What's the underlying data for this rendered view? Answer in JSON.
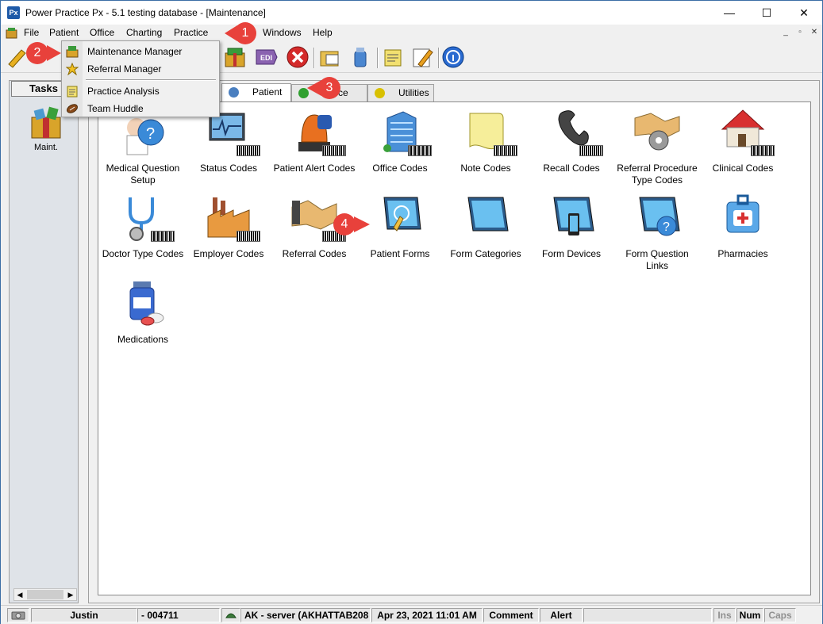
{
  "window": {
    "icon_text": "Px",
    "title": "Power Practice Px - 5.1 testing database - [Maintenance]",
    "minimize_glyph": "—",
    "maximize_glyph": "☐",
    "close_glyph": "✕"
  },
  "menubar": {
    "items": [
      "File",
      "Patient",
      "Office",
      "Charting",
      "Practice",
      "Windows",
      "Help"
    ],
    "mdi_controls": [
      "_",
      "▫",
      "✕"
    ]
  },
  "dropdown": {
    "items": [
      {
        "label": "Maintenance Manager",
        "icon": "maintenance-box-icon"
      },
      {
        "label": "Referral Manager",
        "icon": "star-icon"
      },
      {
        "label": "Practice Analysis",
        "icon": "notepad-icon"
      },
      {
        "label": "Team Huddle",
        "icon": "football-icon"
      }
    ]
  },
  "tasks": {
    "header": "Tasks",
    "items": [
      {
        "label": "Maint.",
        "icon": "maintenance-box-icon"
      }
    ]
  },
  "tabs": [
    {
      "label": "Patient",
      "color": "#4a7fc0"
    },
    {
      "label": "ce",
      "color": "#2fa02f"
    },
    {
      "label": "Utilities",
      "color": "#d8c000"
    }
  ],
  "icons": [
    {
      "label": "Medical Question Setup",
      "icon": "nurse-question-icon"
    },
    {
      "label": "Status Codes",
      "icon": "monitor-barcode-icon"
    },
    {
      "label": "Patient Alert Codes",
      "icon": "siren-icon"
    },
    {
      "label": "Office Codes",
      "icon": "building-icon"
    },
    {
      "label": "Note Codes",
      "icon": "scroll-icon"
    },
    {
      "label": "Recall Codes",
      "icon": "phone-icon"
    },
    {
      "label": "Referral Procedure Type Codes",
      "icon": "handshake-gear-icon"
    },
    {
      "label": "Clinical Codes",
      "icon": "house-icon"
    },
    {
      "label": "Doctor Type Codes",
      "icon": "stethoscope-icon"
    },
    {
      "label": "Employer Codes",
      "icon": "factory-icon"
    },
    {
      "label": "Referral Codes",
      "icon": "handshake-icon"
    },
    {
      "label": "Patient Forms",
      "icon": "tablet-pen-icon"
    },
    {
      "label": "Form Categories",
      "icon": "tablet-icon"
    },
    {
      "label": "Form Devices",
      "icon": "tablet-phone-icon"
    },
    {
      "label": "Form Question Links",
      "icon": "tablet-question-icon"
    },
    {
      "label": "Pharmacies",
      "icon": "first-aid-kit-icon"
    },
    {
      "label": "Medications",
      "icon": "medicine-bottle-icon"
    }
  ],
  "callouts": [
    "1",
    "2",
    "3",
    "4"
  ],
  "statusbar": {
    "user": "Justin",
    "user_id": "- 004711",
    "server": "AK - server (AKHATTAB208",
    "datetime": "Apr 23, 2021 11:01 AM",
    "comment": "Comment",
    "alert": "Alert",
    "ins": "Ins",
    "num": "Num",
    "caps": "Caps"
  },
  "colors": {
    "callout": "#e8413b",
    "title_border": "#3c6ea5"
  }
}
